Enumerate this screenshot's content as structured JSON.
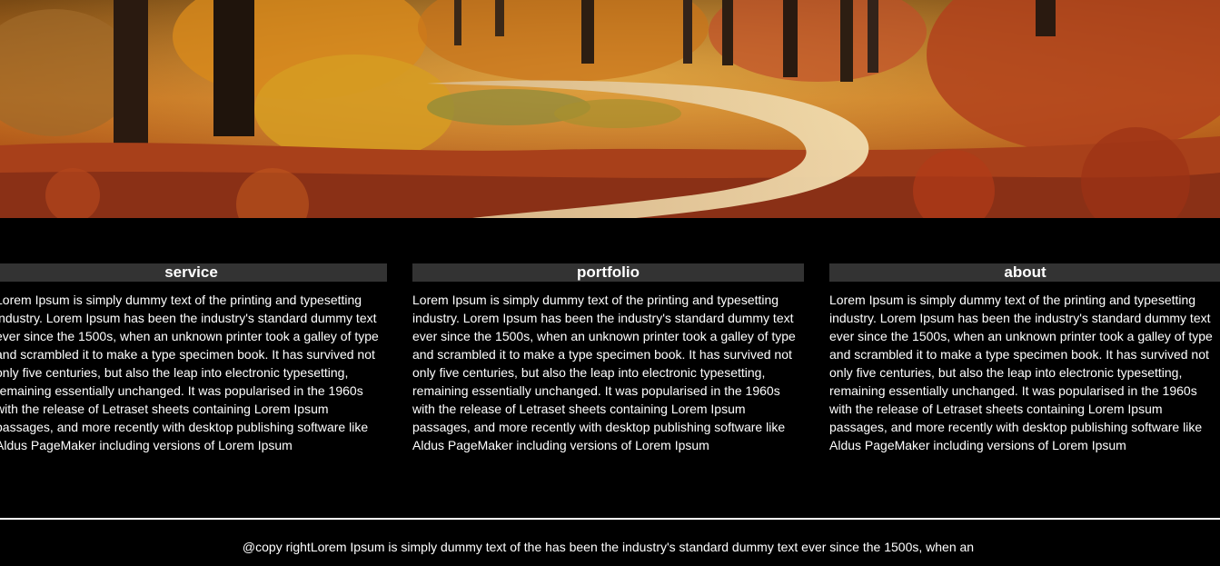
{
  "hero": {
    "image": "autumn-forest-path"
  },
  "sections": [
    {
      "title": "service",
      "body": "Lorem Ipsum is simply dummy text of the printing and typesetting industry. Lorem Ipsum has been the industry's standard dummy text ever since the 1500s, when an unknown printer took a galley of type and scrambled it to make a type specimen book. It has survived not only five centuries, but also the leap into electronic typesetting, remaining essentially unchanged. It was popularised in the 1960s with the release of Letraset sheets containing Lorem Ipsum passages, and more recently with desktop publishing software like Aldus PageMaker including versions of Lorem Ipsum"
    },
    {
      "title": "portfolio",
      "body": "Lorem Ipsum is simply dummy text of the printing and typesetting industry. Lorem Ipsum has been the industry's standard dummy text ever since the 1500s, when an unknown printer took a galley of type and scrambled it to make a type specimen book. It has survived not only five centuries, but also the leap into electronic typesetting, remaining essentially unchanged. It was popularised in the 1960s with the release of Letraset sheets containing Lorem Ipsum passages, and more recently with desktop publishing software like Aldus PageMaker including versions of Lorem Ipsum"
    },
    {
      "title": "about",
      "body": "Lorem Ipsum is simply dummy text of the printing and typesetting industry. Lorem Ipsum has been the industry's standard dummy text ever since the 1500s, when an unknown printer took a galley of type and scrambled it to make a type specimen book. It has survived not only five centuries, but also the leap into electronic typesetting, remaining essentially unchanged. It was popularised in the 1960s with the release of Letraset sheets containing Lorem Ipsum passages, and more recently with desktop publishing software like Aldus PageMaker including versions of Lorem Ipsum"
    }
  ],
  "footer": {
    "text": "@copy rightLorem Ipsum is simply dummy text of the has been the industry's standard dummy text ever since the 1500s, when an"
  },
  "colors": {
    "background": "#000000",
    "section_header": "#333333",
    "text": "#ffffff"
  }
}
